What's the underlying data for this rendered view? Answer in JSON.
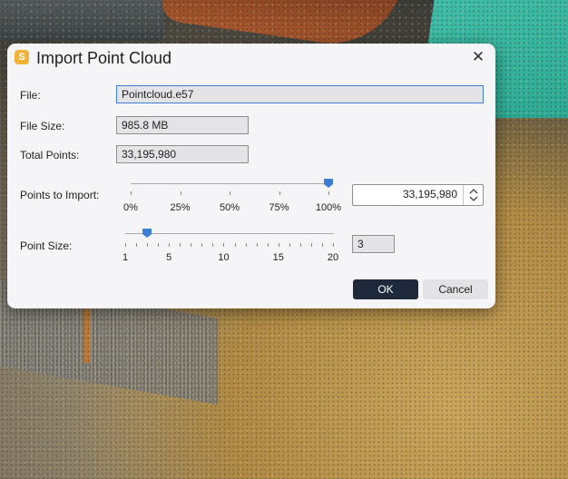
{
  "dialog": {
    "title": "Import Point Cloud",
    "icon": "S",
    "close_icon": "✕"
  },
  "file": {
    "label": "File:",
    "value": "Pointcloud.e57"
  },
  "file_size": {
    "label": "File Size:",
    "value": "985.8 MB"
  },
  "total_points": {
    "label": "Total Points:",
    "value": "33,195,980"
  },
  "points_to_import": {
    "label": "Points to Import:",
    "ticks": [
      "0%",
      "25%",
      "50%",
      "75%",
      "100%"
    ],
    "slider_value_percent": 100,
    "value": "33,195,980"
  },
  "point_size": {
    "label": "Point Size:",
    "ticks": [
      "1",
      "5",
      "10",
      "15",
      "20"
    ],
    "slider_min": 1,
    "slider_max": 20,
    "slider_value": 3,
    "value": "3"
  },
  "buttons": {
    "ok": "OK",
    "cancel": "Cancel"
  },
  "colors": {
    "accent": "#3a7fd2",
    "ok_button": "#1e2a3c",
    "app_icon": "#f0b338"
  }
}
